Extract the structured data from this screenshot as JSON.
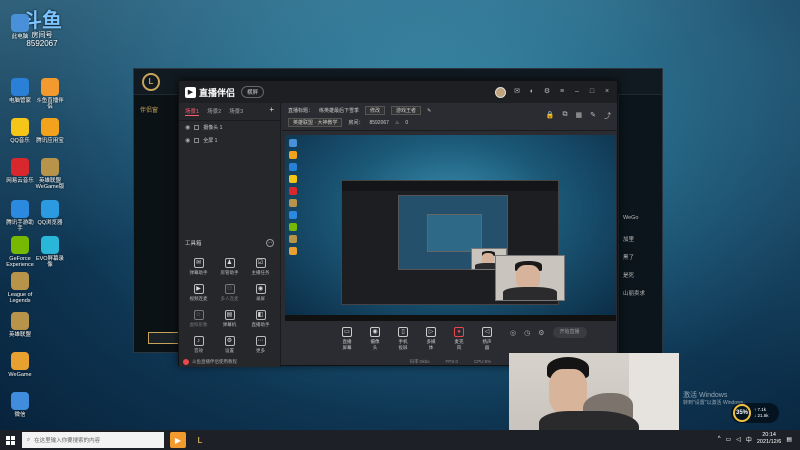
{
  "desktop": {
    "room": {
      "logo": "斗鱼",
      "label": "房间号",
      "number": "8592067"
    },
    "icons": [
      {
        "label": "此电脑",
        "icon": "computer-icon",
        "color": "#4a90d9"
      },
      {
        "label": "魔兽争霸官方对战平台",
        "icon": "warcraft-icon",
        "color": "#7a4a20"
      },
      {
        "label": "电脑管家",
        "icon": "shield-icon",
        "color": "#2a7fd6"
      },
      {
        "label": "斗鱼直播伴侣",
        "icon": "douyu-icon",
        "color": "#f29a2e"
      },
      {
        "label": "QQ音乐",
        "icon": "qqmusic-icon",
        "color": "#f5c518"
      },
      {
        "label": "腾讯应用宝",
        "icon": "appstore-icon",
        "color": "#f2a31b"
      },
      {
        "label": "网易云音乐",
        "icon": "netease-music-icon",
        "color": "#d8282e"
      },
      {
        "label": "英雄联盟WeGame版",
        "icon": "lol-icon",
        "color": "#b8934a"
      },
      {
        "label": "腾讯手游助手",
        "icon": "tencent-mobile-icon",
        "color": "#2b8ae0"
      },
      {
        "label": "QQ浏览器",
        "icon": "qq-browser-icon",
        "color": "#2b9ae0"
      },
      {
        "label": "GeForce Experience",
        "icon": "nvidia-icon",
        "color": "#76b900"
      },
      {
        "label": "EVO屏幕录像",
        "icon": "evo-icon",
        "color": "#29b6d8"
      },
      {
        "label": "League of Legends",
        "icon": "lol-icon",
        "color": "#b8934a"
      },
      {
        "label": "英雄联盟",
        "icon": "lol-icon",
        "color": "#b8934a"
      },
      {
        "label": "WeGame",
        "icon": "wegame-icon",
        "color": "#e8a030"
      },
      {
        "label": "微信",
        "icon": "wechat-icon",
        "color": "#3f8ddc"
      }
    ]
  },
  "lol": {
    "logo_text": "L",
    "side_label": "伴侣窗",
    "right_panel": [
      "WeGo",
      "加里",
      "黑了",
      "是死",
      "山丽卖求"
    ]
  },
  "app": {
    "title": "直播伴侣",
    "mode_button": "横屏",
    "scene_tabs": [
      "场景1",
      "场景2",
      "场景3"
    ],
    "sources": [
      {
        "label": "摄像头 1"
      },
      {
        "label": "全屏 1"
      }
    ],
    "toolbox_label": "工具箱",
    "tools": [
      {
        "label": "弹幕助手",
        "icon": "danmaku-icon",
        "dim": false
      },
      {
        "label": "房管助手",
        "icon": "user-icon",
        "dim": false
      },
      {
        "label": "主播任务",
        "icon": "task-icon",
        "dim": false
      },
      {
        "label": "视频连麦",
        "icon": "video-icon",
        "dim": false
      },
      {
        "label": "多人连麦",
        "icon": "group-icon",
        "dim": true
      },
      {
        "label": "录屏",
        "icon": "record-icon",
        "dim": false
      },
      {
        "label": "虚拟形象",
        "icon": "avatar-icon",
        "dim": true
      },
      {
        "label": "弹幕机",
        "icon": "board-icon",
        "dim": false
      },
      {
        "label": "直播助手",
        "icon": "assistant-icon",
        "dim": false
      },
      {
        "label": "音效",
        "icon": "sound-icon",
        "dim": false
      },
      {
        "label": "设置",
        "icon": "settings-icon",
        "dim": false
      },
      {
        "label": "更多",
        "icon": "more-icon",
        "dim": false
      }
    ],
    "footer": "斗鱼直播伴侣使用教程",
    "info": {
      "title_label": "直播标题：",
      "title_value": "练英雄最后下雪季",
      "edit_label": "修改",
      "category_label": "游戏王者",
      "area_label": "英雄联盟 · 大神教学",
      "room_label": "房间：",
      "room_value": "8592067",
      "hot": "0"
    },
    "controls": [
      {
        "label": "直播屏幕",
        "icon": "monitor-icon"
      },
      {
        "label": "摄像头",
        "icon": "camera-icon"
      },
      {
        "label": "手机投屏",
        "icon": "phone-cast-icon"
      },
      {
        "label": "多媒体",
        "icon": "media-icon"
      },
      {
        "label": "麦克风",
        "icon": "mic-icon",
        "mic": true
      },
      {
        "label": "扬声器",
        "icon": "speaker-icon"
      }
    ],
    "go_live": "开始直播",
    "status": [
      "码率:0kbs",
      "FPS:0",
      "CPU:5%"
    ]
  },
  "activate": {
    "line1": "激活 Windows",
    "line2": "转到\"设置\"以激活 Windows。"
  },
  "perf": {
    "percent": "35%",
    "up": "↑ 7.1k",
    "down": "↓ 21.6k"
  },
  "taskbar": {
    "search_placeholder": "在这里输入你要搜索的内容",
    "time": "20:14",
    "date": "2021/12/6"
  }
}
